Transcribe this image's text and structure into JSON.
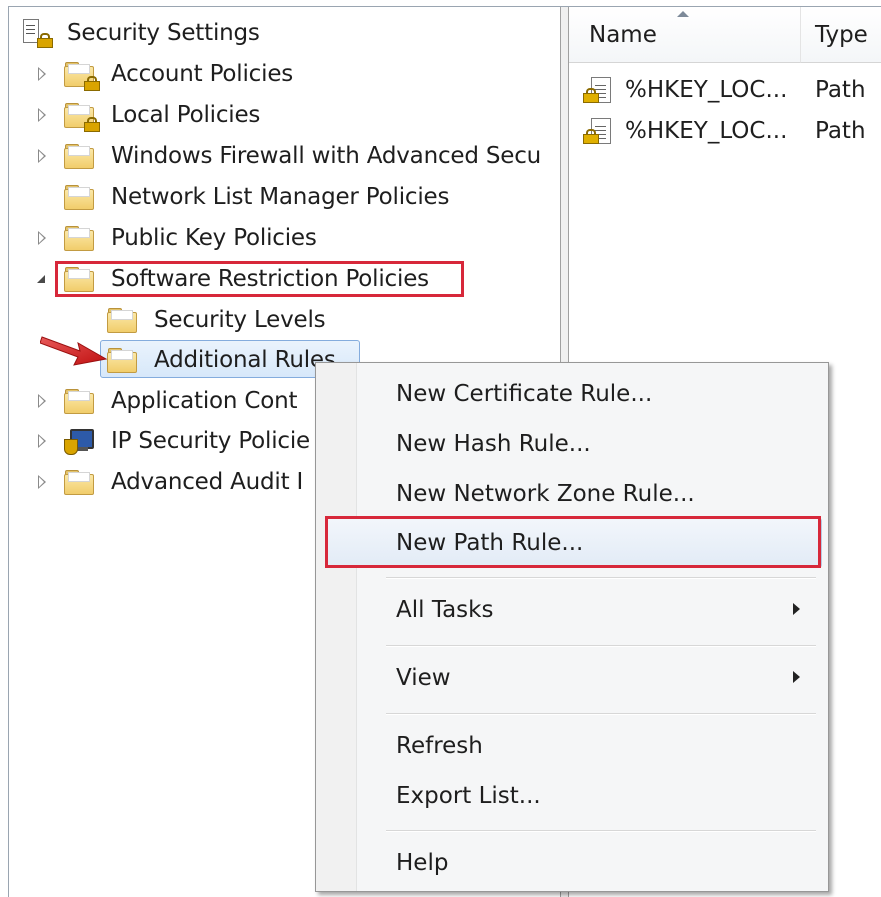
{
  "tree": {
    "root_label": "Security Settings",
    "items": [
      {
        "label": "Account Policies"
      },
      {
        "label": "Local Policies"
      },
      {
        "label": "Windows Firewall with Advanced Secu"
      },
      {
        "label": "Network List Manager Policies"
      },
      {
        "label": "Public Key Policies"
      },
      {
        "label": "Software Restriction Policies"
      },
      {
        "label": "Security Levels"
      },
      {
        "label": "Additional Rules"
      },
      {
        "label": "Application Cont"
      },
      {
        "label": "IP Security Policie"
      },
      {
        "label": "Advanced Audit I"
      }
    ]
  },
  "list": {
    "columns": [
      "Name",
      "Type"
    ],
    "rows": [
      {
        "name": "%HKEY_LOC...",
        "type": "Path"
      },
      {
        "name": "%HKEY_LOC...",
        "type": "Path"
      }
    ]
  },
  "context_menu": {
    "items": [
      {
        "label": "New Certificate Rule..."
      },
      {
        "label": "New Hash Rule..."
      },
      {
        "label": "New Network Zone Rule..."
      },
      {
        "label": "New Path Rule..."
      },
      {
        "label": "All Tasks"
      },
      {
        "label": "View"
      },
      {
        "label": "Refresh"
      },
      {
        "label": "Export List..."
      },
      {
        "label": "Help"
      }
    ]
  },
  "colors": {
    "highlight_box": "#d7283a",
    "selection_fill": "#d7e8fa",
    "menu_background": "#f5f6f7"
  }
}
